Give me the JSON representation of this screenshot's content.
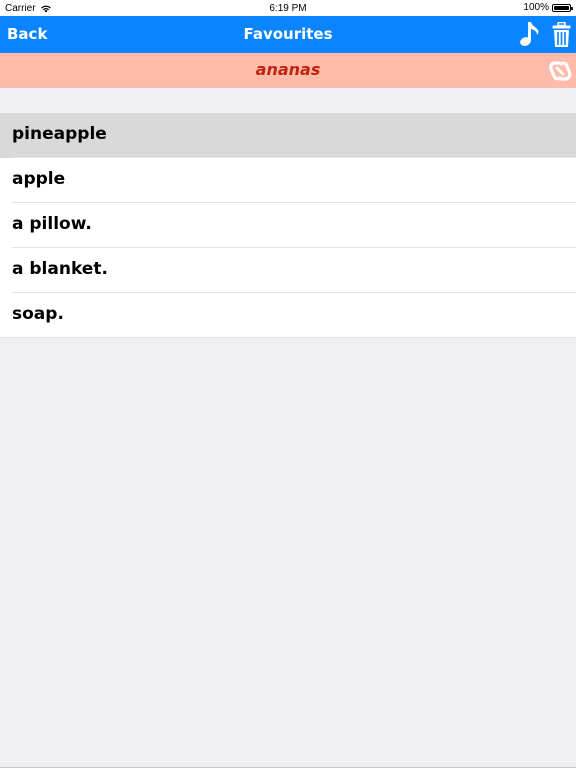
{
  "status_bar": {
    "carrier": "Carrier",
    "time": "6:19 PM",
    "battery": "100%"
  },
  "nav": {
    "back_label": "Back",
    "title": "Favourites",
    "music_icon": "music-note-icon",
    "trash_icon": "trash-icon"
  },
  "translation": {
    "word": "ananas",
    "link_icon": "link-icon"
  },
  "favourites": [
    {
      "label": "pineapple",
      "selected": true
    },
    {
      "label": "apple",
      "selected": false
    },
    {
      "label": "a pillow.",
      "selected": false
    },
    {
      "label": "a blanket.",
      "selected": false
    },
    {
      "label": "soap.",
      "selected": false
    }
  ],
  "colors": {
    "nav_bg": "#0a84ff",
    "translation_bg": "#ffbaaa",
    "translation_text": "#c0250d",
    "page_bg": "#efeff4",
    "selected_row": "#d9d9d9"
  }
}
